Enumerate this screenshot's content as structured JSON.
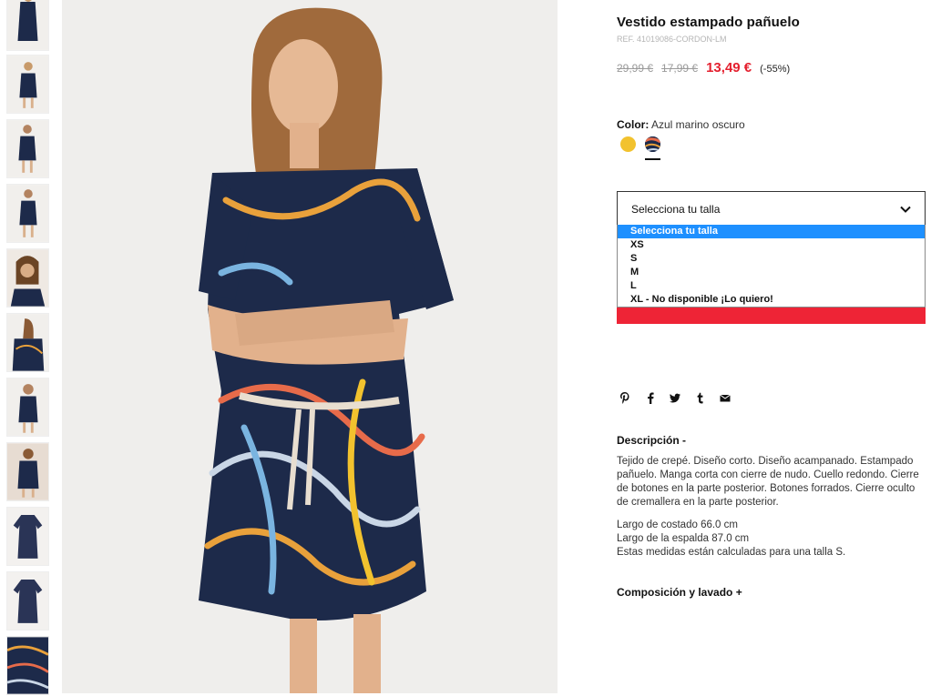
{
  "product": {
    "title": "Vestido estampado pañuelo",
    "ref": "REF. 41019086-CORDON-LM",
    "price_original": "29,99 €",
    "price_previous": "17,99 €",
    "price_current": "13,49 €",
    "discount": "(-55%)"
  },
  "color": {
    "label": "Color:",
    "value": "Azul marino oscuro",
    "swatches": [
      {
        "name": "yellow",
        "color": "#f2c22e"
      },
      {
        "name": "navy-print",
        "color": "#1d2a4a",
        "selected": true
      }
    ]
  },
  "size": {
    "placeholder": "Selecciona tu talla",
    "options": [
      "Selecciona tu talla",
      "XS",
      "S",
      "M",
      "L",
      "XL - No disponible ¡Lo quiero!"
    ],
    "highlighted_index": 0
  },
  "share_icons": [
    "pinterest-icon",
    "facebook-icon",
    "twitter-icon",
    "tumblr-icon",
    "email-icon"
  ],
  "description": {
    "title": "Descripción -",
    "text": "Tejido de crepé. Diseño corto. Diseño acampanado. Estampado pañuelo. Manga corta con cierre de nudo. Cuello redondo. Cierre de botones en la parte posterior. Botones forrados. Cierre oculto de cremallera en la parte posterior.",
    "measure_1": "Largo de costado 66.0 cm",
    "measure_2": "Largo de la espalda 87.0 cm",
    "measure_note": "Estas medidas están calculadas para una talla S."
  },
  "composition": {
    "title": "Composición y lavado +"
  },
  "colors": {
    "accent_red": "#e4202f",
    "dropdown_highlight": "#1e90ff",
    "dress_navy": "#1d2a4a"
  }
}
